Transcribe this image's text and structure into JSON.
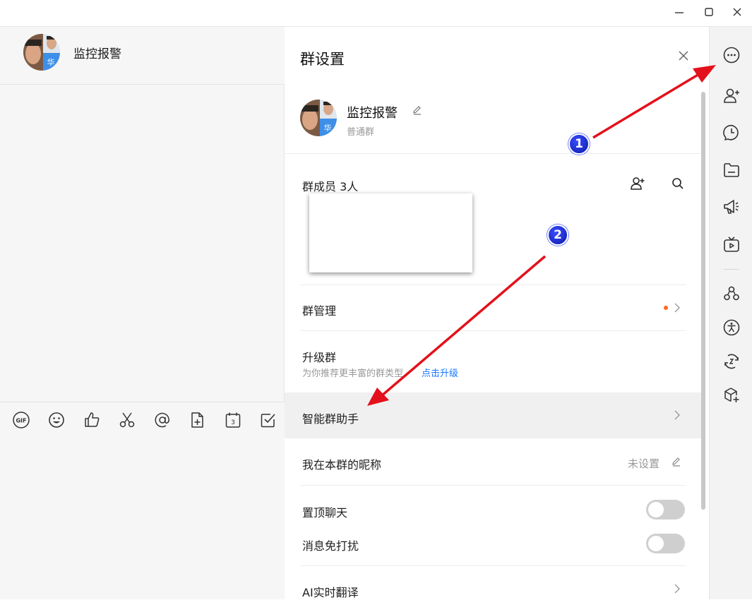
{
  "window": {
    "minimize": "minimize",
    "maximize": "maximize",
    "close": "close"
  },
  "chat": {
    "group_name": "监控报警",
    "avatar_badge": "华",
    "toolbar_icons": [
      "gif-icon",
      "emoji-icon",
      "thumbs-up-icon",
      "scissors-icon",
      "at-icon",
      "file-add-icon",
      "calendar-icon",
      "checkbox-icon"
    ],
    "calendar_day": "3",
    "gif_text": "GIF"
  },
  "settings": {
    "title": "群设置",
    "group_name": "监控报警",
    "group_type": "普通群",
    "avatar_badge": "华",
    "members_label": "群成员 3人",
    "manage_label": "群管理",
    "manage_dot_color": "#ff6a1a",
    "upgrade_label": "升级群",
    "upgrade_sub": "为你推荐更丰富的群类型",
    "upgrade_link": "点击升级",
    "assistant_label": "智能群助手",
    "nickname_label": "我在本群的昵称",
    "nickname_value": "未设置",
    "pin_label": "置顶聊天",
    "pin_on": false,
    "mute_label": "消息免打扰",
    "mute_on": false,
    "translate_label": "AI实时翻译"
  },
  "rail_icons": [
    "more-icon",
    "add-member-icon",
    "history-icon",
    "folder-icon",
    "announcement-icon",
    "live-icon",
    "apps-icon",
    "accessibility-icon",
    "sync-icon",
    "add-plugin-icon"
  ],
  "annotations": {
    "step1": "1",
    "step2": "2",
    "arrow_color": "#e3111b"
  }
}
